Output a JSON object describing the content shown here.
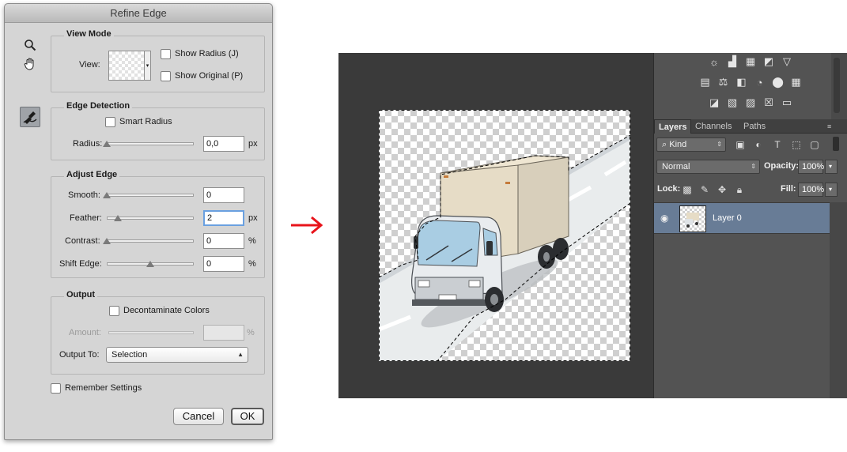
{
  "dialog": {
    "title": "Refine Edge",
    "view_mode": {
      "title": "View Mode",
      "view_label": "View:",
      "show_radius": "Show Radius (J)",
      "show_original": "Show Original (P)"
    },
    "edge_detection": {
      "title": "Edge Detection",
      "smart_radius": "Smart Radius",
      "radius_label": "Radius:",
      "radius_value": "0,0",
      "radius_unit": "px",
      "radius_level": 0
    },
    "adjust_edge": {
      "title": "Adjust Edge",
      "smooth_label": "Smooth:",
      "smooth_value": "0",
      "smooth_level": 0,
      "feather_label": "Feather:",
      "feather_value": "2",
      "feather_unit": "px",
      "feather_level": 0.13,
      "contrast_label": "Contrast:",
      "contrast_value": "0",
      "contrast_unit": "%",
      "contrast_level": 0,
      "shift_label": "Shift Edge:",
      "shift_value": "0",
      "shift_unit": "%",
      "shift_level": 0.5
    },
    "output": {
      "title": "Output",
      "decontaminate": "Decontaminate Colors",
      "amount_label": "Amount:",
      "amount_unit": "%",
      "output_to_label": "Output To:",
      "output_to_value": "Selection"
    },
    "remember_settings": "Remember Settings",
    "cancel": "Cancel",
    "ok": "OK"
  },
  "layers_panel": {
    "tabs": [
      "Layers",
      "Channels",
      "Paths"
    ],
    "filter_kind": "Kind",
    "blend_mode": "Normal",
    "opacity_label": "Opacity:",
    "opacity_value": "100%",
    "lock_label": "Lock:",
    "fill_label": "Fill:",
    "fill_value": "100%",
    "layer_name": "Layer 0"
  },
  "colors": {
    "arrow": "#e8141b",
    "layer_selected": "#687c96",
    "canvas_bg": "#3a3a3a"
  }
}
